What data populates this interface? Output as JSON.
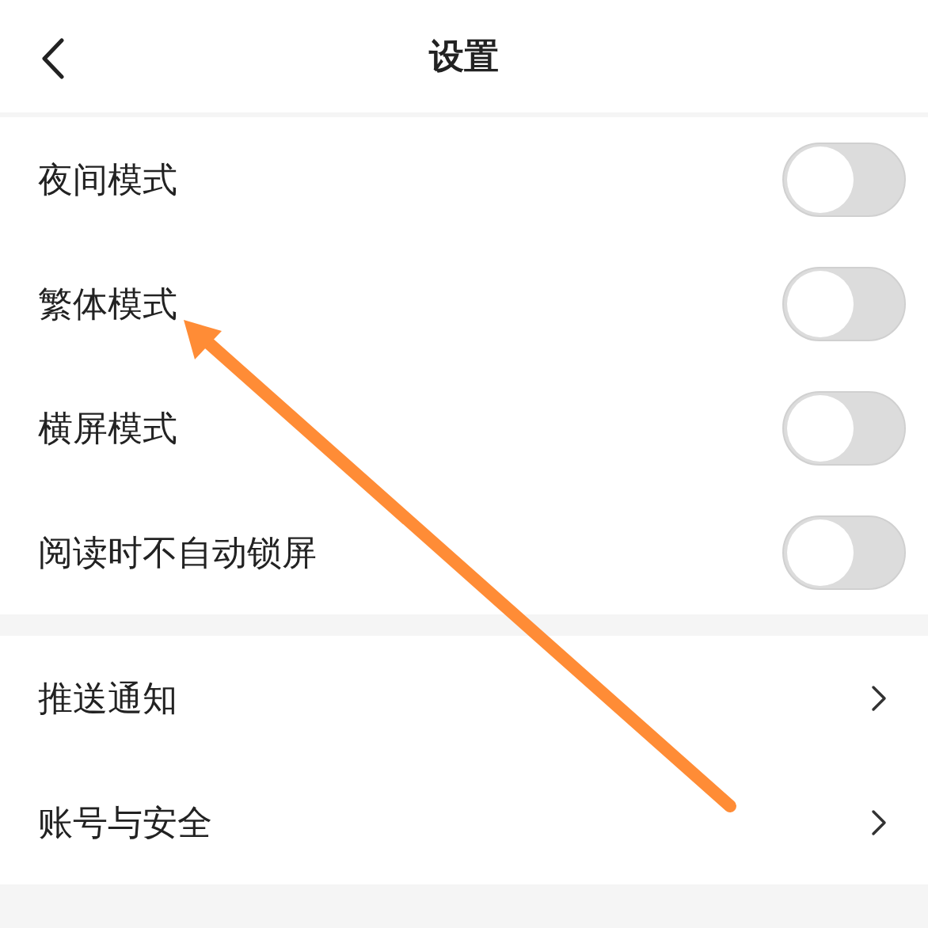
{
  "header": {
    "title": "设置"
  },
  "toggles": [
    {
      "label": "夜间模式",
      "on": false
    },
    {
      "label": "繁体模式",
      "on": false
    },
    {
      "label": "横屏模式",
      "on": false
    },
    {
      "label": "阅读时不自动锁屏",
      "on": false
    }
  ],
  "links": [
    {
      "label": "推送通知"
    },
    {
      "label": "账号与安全"
    }
  ]
}
